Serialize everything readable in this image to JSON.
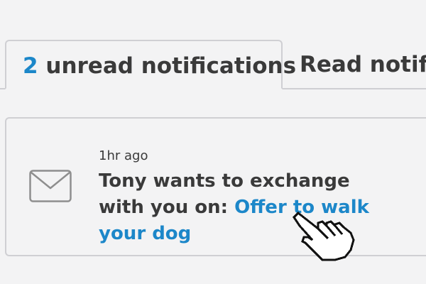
{
  "tabs": {
    "unread": {
      "count": "2",
      "label": "unread notifications"
    },
    "read": {
      "label": "Read notifications"
    }
  },
  "notification": {
    "time": "1hr ago",
    "message_prefix": "Tony wants to exchange with you on:",
    "link_text": "Offer to walk your dog",
    "icon": "envelope-icon"
  },
  "cursor": {
    "icon": "hand-pointer-cursor-icon"
  },
  "colors": {
    "accent": "#1c87c9",
    "text": "#3a3a3a",
    "border": "#cfcfd3",
    "background": "#f3f3f4"
  }
}
